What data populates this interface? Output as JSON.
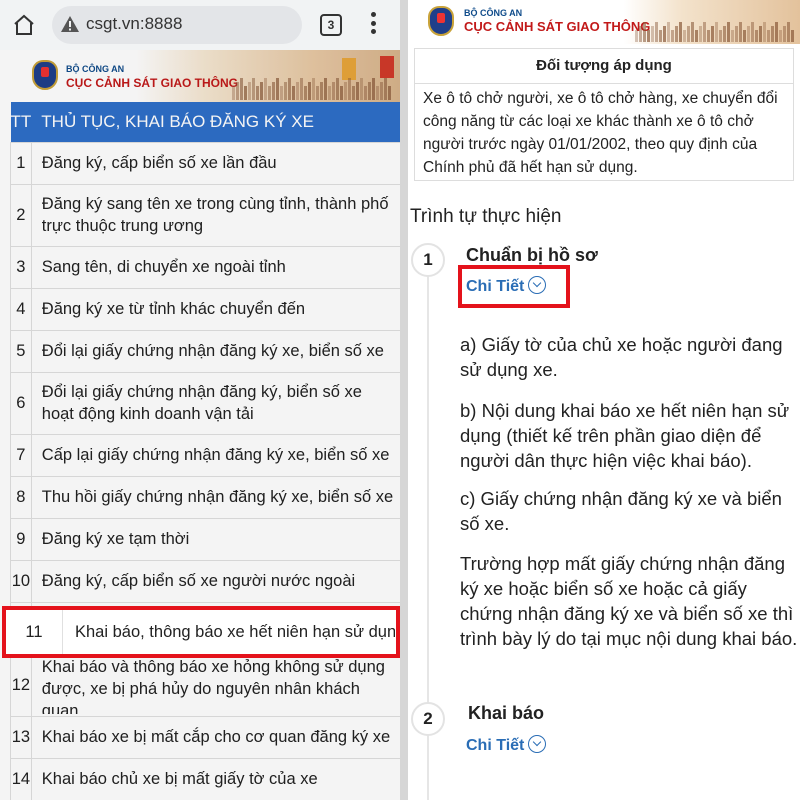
{
  "left": {
    "browser": {
      "url": "csgt.vn:8888",
      "tab_count": "3"
    },
    "banner": {
      "org_small": "BỘ CÔNG AN",
      "org_big": "CỤC CẢNH SÁT GIAO THÔNG"
    },
    "table": {
      "headers": [
        "TT",
        "THỦ TỤC, KHAI BÁO ĐĂNG KÝ XE"
      ],
      "rows": [
        {
          "tt": "1",
          "name": "Đăng ký, cấp biển số xe lần đầu"
        },
        {
          "tt": "2",
          "name": "Đăng ký sang tên xe trong cùng tỉnh, thành phố trực thuộc trung ương"
        },
        {
          "tt": "3",
          "name": "Sang tên, di chuyển xe ngoài tỉnh"
        },
        {
          "tt": "4",
          "name": "Đăng ký xe từ tỉnh khác chuyển đến"
        },
        {
          "tt": "5",
          "name": "Đổi lại giấy chứng nhận đăng ký xe, biển số xe"
        },
        {
          "tt": "6",
          "name": "Đổi lại giấy chứng nhận đăng ký, biển số xe hoạt động kinh doanh vận tải"
        },
        {
          "tt": "7",
          "name": "Cấp lại giấy chứng nhận đăng ký xe, biển số xe"
        },
        {
          "tt": "8",
          "name": "Thu hồi giấy chứng nhận đăng ký xe, biển số xe"
        },
        {
          "tt": "9",
          "name": "Đăng ký xe tạm thời"
        },
        {
          "tt": "10",
          "name": "Đăng ký, cấp biển số xe người nước ngoài"
        },
        {
          "tt": "11",
          "name": "Khai báo, thông báo xe hết niên hạn sử dụng"
        },
        {
          "tt": "12",
          "name": "Khai báo và thông báo xe hỏng không sử dụng được, xe bị phá hủy do nguyên nhân khách quan"
        },
        {
          "tt": "13",
          "name": "Khai báo xe bị mất cắp cho cơ quan đăng ký xe"
        },
        {
          "tt": "14",
          "name": "Khai báo chủ xe bị mất giấy tờ của xe"
        }
      ]
    }
  },
  "right": {
    "banner": {
      "org_small": "BỘ CÔNG AN",
      "org_big": "CỤC CẢNH SÁT GIAO THÔNG"
    },
    "applicable": {
      "heading": "Đối tượng áp dụng",
      "text": "Xe ô tô chở người, xe ô tô chở hàng, xe chuyển đổi công năng từ các loại xe khác thành xe ô tô chở người trước ngày 01/01/2002, theo quy định của Chính phủ đã hết hạn sử dụng."
    },
    "section_title": "Trình tự thực hiện",
    "steps": [
      {
        "num": "1",
        "title": "Chuẩn bị hồ sơ",
        "detail": "Chi Tiết",
        "paragraphs": [
          "a) Giấy tờ của chủ xe hoặc người đang sử dụng xe.",
          "b) Nội dung khai báo xe hết niên hạn sử dụng (thiết kế trên phần giao diện để người dân thực hiện việc khai báo).",
          "c) Giấy chứng nhận đăng ký xe và biển số xe.",
          "Trường hợp mất giấy chứng nhận đăng ký xe hoặc biển số xe hoặc cả giấy chứng nhận đăng ký xe và biển số xe thì trình bày lý do tại mục nội dung khai báo."
        ]
      },
      {
        "num": "2",
        "title": "Khai báo",
        "detail": "Chi Tiết"
      }
    ]
  }
}
